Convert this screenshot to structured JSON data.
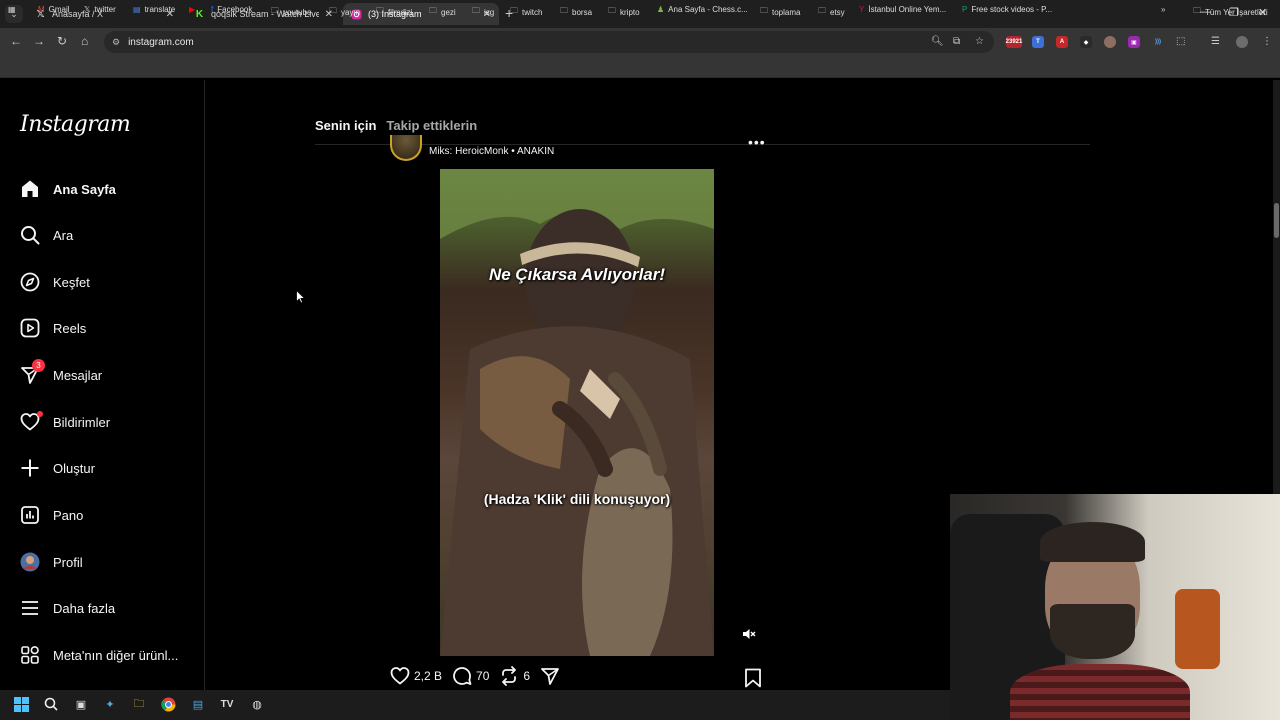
{
  "browser": {
    "tabs": [
      {
        "title": "Anasayfa / X",
        "favicon": "x-logo",
        "active": false
      },
      {
        "title": "qoqsik Stream - Watch Live on",
        "favicon": "kick-logo",
        "active": false
      },
      {
        "title": "(3) Instagram",
        "favicon": "instagram-logo",
        "active": true
      }
    ],
    "url": "instagram.com",
    "extension_badge": "23921",
    "bookmarks": [
      {
        "label": "Gmail",
        "icon": "gmail-icon"
      },
      {
        "label": "twitter",
        "icon": "x-icon"
      },
      {
        "label": "translate",
        "icon": "translate-icon"
      },
      {
        "label": "",
        "icon": "youtube-icon"
      },
      {
        "label": "Facebook",
        "icon": "facebook-icon"
      },
      {
        "label": "youtube",
        "icon": "folder-icon"
      },
      {
        "label": "yayın",
        "icon": "folder-icon"
      },
      {
        "label": "filmdizi",
        "icon": "folder-icon"
      },
      {
        "label": "gezi",
        "icon": "folder-icon"
      },
      {
        "label": "isg",
        "icon": "folder-icon"
      },
      {
        "label": "twitch",
        "icon": "folder-icon"
      },
      {
        "label": "borsa",
        "icon": "folder-icon"
      },
      {
        "label": "kripto",
        "icon": "folder-icon"
      },
      {
        "label": "Ana Sayfa - Chess.c...",
        "icon": "chess-icon"
      },
      {
        "label": "toplama",
        "icon": "folder-icon"
      },
      {
        "label": "etsy",
        "icon": "folder-icon"
      },
      {
        "label": "İstanbul Online Yem...",
        "icon": "yemek-icon"
      },
      {
        "label": "Free stock videos - P...",
        "icon": "pexels-icon"
      }
    ],
    "all_bookmarks": "Tüm Yer İşaretleri"
  },
  "instagram": {
    "logo": "Instagram",
    "nav": [
      {
        "label": "Ana Sayfa",
        "icon": "home-icon",
        "active": true
      },
      {
        "label": "Ara",
        "icon": "search-icon"
      },
      {
        "label": "Keşfet",
        "icon": "compass-icon"
      },
      {
        "label": "Reels",
        "icon": "reels-icon"
      },
      {
        "label": "Mesajlar",
        "icon": "messenger-icon",
        "badge": "3"
      },
      {
        "label": "Bildirimler",
        "icon": "heart-icon",
        "dot": true
      },
      {
        "label": "Oluştur",
        "icon": "plus-icon"
      },
      {
        "label": "Pano",
        "icon": "dashboard-icon"
      },
      {
        "label": "Profil",
        "icon": "profile-avatar"
      },
      {
        "label": "Daha fazla",
        "icon": "menu-icon"
      },
      {
        "label": "Meta'nın diğer ürünl...",
        "icon": "meta-apps-icon"
      }
    ],
    "feed_tabs": {
      "for_you": "Senin için",
      "following": "Takip ettiklerin"
    },
    "post": {
      "audio": "Miks: HeroicMonk • ANAKIN",
      "caption_top": "Ne Çıkarsa Avlıyorlar!",
      "caption_bottom": "(Hadza 'Klik' dili konuşuyor)",
      "likes": "2,2 B",
      "comments": "70",
      "reposts": "6"
    }
  }
}
